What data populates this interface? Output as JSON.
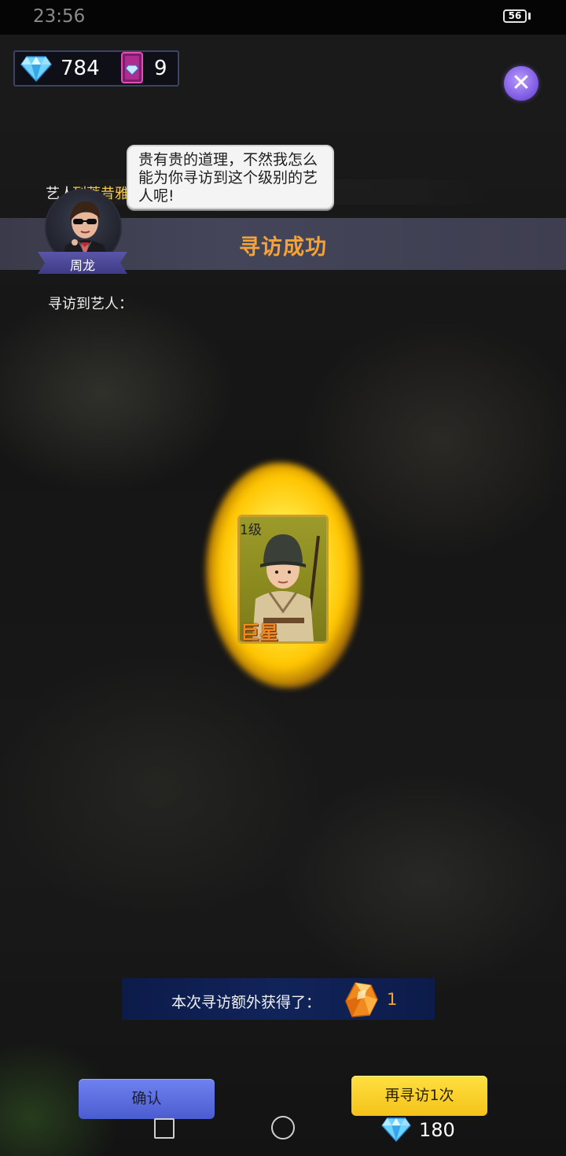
{
  "status_bar": {
    "time": "23:56",
    "battery": "56"
  },
  "resources": {
    "diamonds": "784",
    "tickets": "9"
  },
  "close_button": {
    "label": "✕"
  },
  "dialog": {
    "speech": "贵有贵的道理，不然我怎么能为你寻访到这个级别的艺人呢!",
    "artist_prefix": "艺人",
    "artist_name": "列蒂昔雅",
    "speaker_name": "周龙"
  },
  "banner": {
    "title": "寻访成功"
  },
  "found_label": "寻访到艺人：",
  "card": {
    "level": "1级",
    "rank": "巨星"
  },
  "bonus": {
    "text": "本次寻访额外获得了：",
    "count": "1"
  },
  "buttons": {
    "confirm": "确认",
    "search_again": "再寻访1次"
  },
  "cost": {
    "diamonds": "180"
  },
  "icons": {
    "diamond": "diamond-icon",
    "ticket": "ticket-card-icon",
    "amber": "amber-crystal-icon",
    "close": "close-icon"
  },
  "colors": {
    "accent_orange": "#f5a339",
    "artist_name": "#f2c94c",
    "confirm_blue": "#5b6ee0",
    "again_yellow": "#f8cf2a"
  }
}
